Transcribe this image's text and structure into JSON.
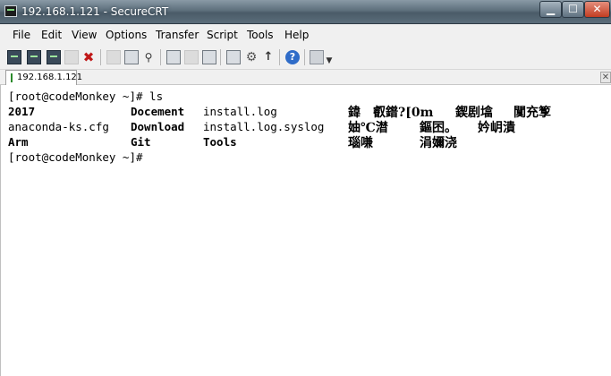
{
  "window": {
    "title": "192.168.1.121 - SecureCRT",
    "minimize_glyph": "▁",
    "maximize_glyph": "☐",
    "close_glyph": "✕"
  },
  "menu": {
    "items": [
      "File",
      "Edit",
      "View",
      "Options",
      "Transfer",
      "Script",
      "Tools",
      "Help"
    ]
  },
  "toolbar": {
    "icons": [
      "connect-icon",
      "quick-connect-icon",
      "connect-tab-icon",
      "reconnect-icon",
      "disconnect-icon",
      "copy-icon",
      "paste-icon",
      "find-icon",
      "print-icon",
      "print-setup-icon",
      "print-screen-icon",
      "session-options-icon",
      "global-options-icon",
      "keymap-icon",
      "help-icon",
      "screenshot-icon",
      "toolbar-overflow-icon"
    ]
  },
  "tabs": {
    "active_label": "192.168.1.121",
    "close_glyph": "✕"
  },
  "terminal": {
    "prompt1": "[root@codeMonkey ~]# ls",
    "row1": [
      "2017",
      "Docement",
      "install.log",
      "鍏　叡鐠?[0m",
      "鍥剧墖",
      "闃充箰"
    ],
    "row2": [
      "anaconda-ks.cfg",
      "Download",
      "install.log.syslog",
      "妯℃澘",
      "鏂囨。",
      "妗岄潰"
    ],
    "row3": [
      "Arm",
      "Git",
      "Tools",
      "瑙嗛",
      "涓嬭浇"
    ],
    "prompt2": "[root@codeMonkey ~]#"
  },
  "colors": {
    "titlebar": "#5d6f7c",
    "close_button": "#c23d22",
    "terminal_bg": "#ffffff",
    "terminal_fg": "#000000",
    "tab_marker": "#2b8a2b"
  }
}
